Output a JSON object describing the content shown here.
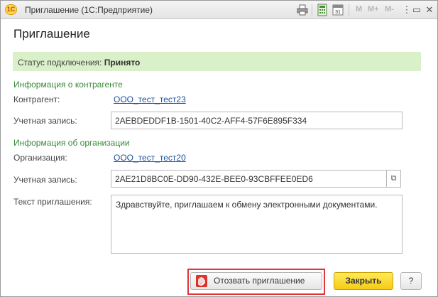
{
  "window": {
    "logo_text": "1С",
    "title": "Приглашение  (1С:Предприятие)",
    "toolbar": {
      "m": "M",
      "m_plus": "M+",
      "m_minus": "M-"
    },
    "icons": [
      "print-icon",
      "calculator-icon",
      "calendar-icon",
      "more-icon",
      "minimize-icon",
      "maximize-icon",
      "close-icon"
    ]
  },
  "form": {
    "title": "Приглашение",
    "status": {
      "label": "Статус подключения:",
      "value": "Принято",
      "bg_color": "#d9f0c9"
    },
    "counterparty_section": {
      "heading": "Информация о контрагенте",
      "counterparty_label": "Контрагент:",
      "counterparty_value": "ООО_тест_тест23",
      "account_label": "Учетная запись:",
      "account_value": "2AEBDEDDF1B-1501-40C2-AFF4-57F6E895F334"
    },
    "organization_section": {
      "heading": "Информация об организации",
      "organization_label": "Организация:",
      "organization_value": "ООО_тест_тест20",
      "account_label": "Учетная запись:",
      "account_value": "2AE21D8BC0E-DD90-432E-BEE0-93CBFFEE0ED6"
    },
    "invitation": {
      "label": "Текст приглашения:",
      "text": "Здравствуйте, приглашаем к обмену электронными документами."
    }
  },
  "buttons": {
    "revoke": "Отозвать приглашение",
    "close": "Закрыть",
    "help": "?"
  },
  "colors": {
    "section_heading": "#3a8a3a",
    "link": "#1a4f9e",
    "primary_button": "#f5cc14",
    "highlight_frame": "#e0353a"
  }
}
